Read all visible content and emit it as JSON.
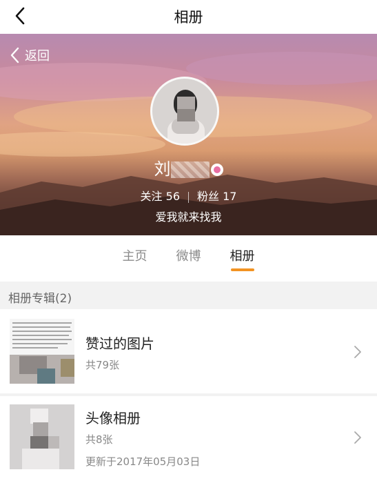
{
  "topbar": {
    "title": "相册"
  },
  "banner": {
    "back_label": "返回",
    "username_visible": "刘",
    "follow_label": "关注",
    "follow_count": "56",
    "fans_label": "粉丝",
    "fans_count": "17",
    "bio": "爱我就来找我"
  },
  "tabs": [
    {
      "label": "主页",
      "active": false
    },
    {
      "label": "微博",
      "active": false
    },
    {
      "label": "相册",
      "active": true
    }
  ],
  "albums_section": {
    "title": "相册专辑(2)"
  },
  "albums": [
    {
      "name": "赞过的图片",
      "count": "共79张",
      "updated": ""
    },
    {
      "name": "头像相册",
      "count": "共8张",
      "updated": "更新于2017年05月03日"
    }
  ],
  "colors": {
    "accent": "#f29322",
    "section_bg": "#f2f2f2"
  }
}
